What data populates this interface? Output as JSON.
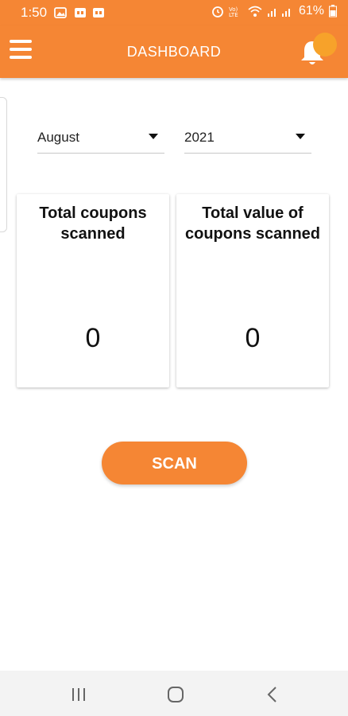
{
  "status_bar": {
    "time": "1:50",
    "battery": "61%"
  },
  "app_bar": {
    "title": "DASHBOARD"
  },
  "filters": {
    "month": "August",
    "year": "2021"
  },
  "cards": [
    {
      "label": "Total coupons scanned",
      "value": "0"
    },
    {
      "label": "Total value of coupons scanned",
      "value": "0"
    }
  ],
  "scan_button": {
    "label": "SCAN"
  },
  "colors": {
    "accent": "#f58634",
    "badge": "#f7a22a"
  },
  "icons": {
    "menu": "hamburger-menu-icon",
    "notifications": "bell-icon",
    "dropdown": "caret-down-icon",
    "nav_recents": "recents-icon",
    "nav_home": "home-icon",
    "nav_back": "back-icon"
  }
}
